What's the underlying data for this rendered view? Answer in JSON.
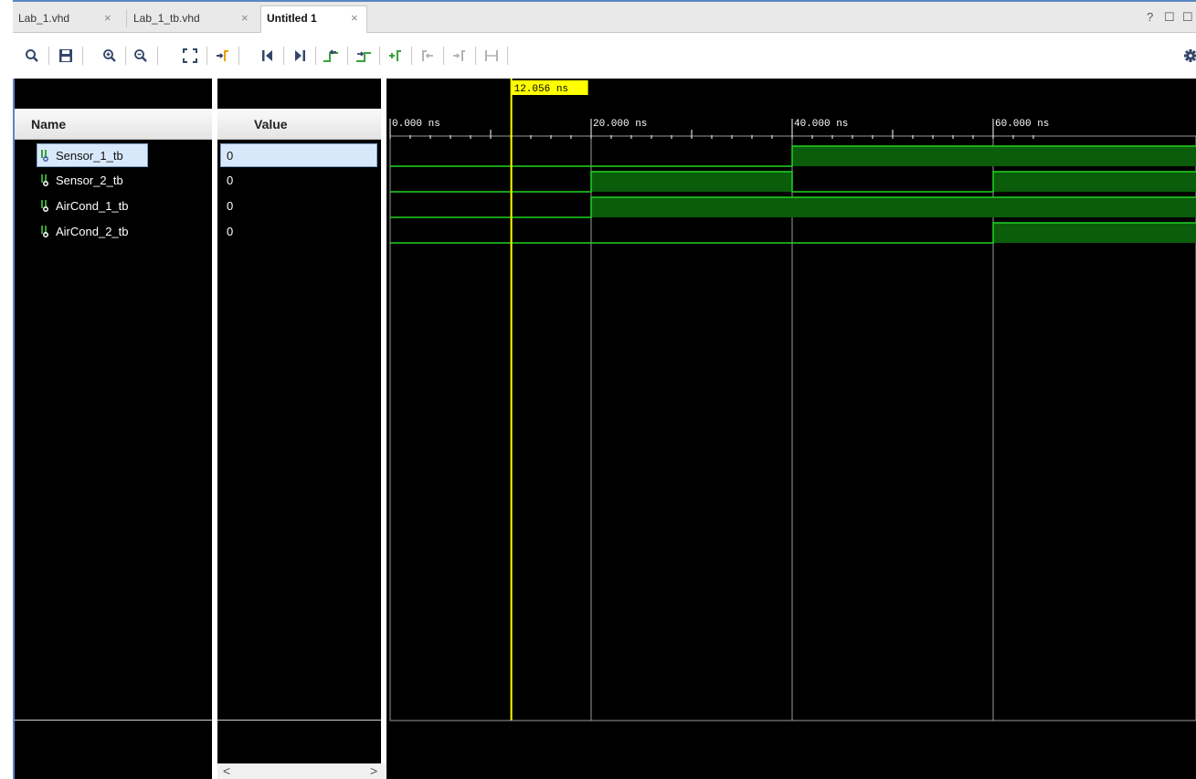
{
  "tabs": [
    {
      "label": "Lab_1.vhd",
      "active": false
    },
    {
      "label": "Lab_1_tb.vhd",
      "active": false
    },
    {
      "label": "Untitled 1",
      "active": true
    }
  ],
  "tab_close_glyph": "×",
  "window_controls": [
    "?",
    "☐",
    "☐"
  ],
  "toolbar": {
    "buttons": [
      {
        "icon": "search-icon",
        "enabled": true
      },
      {
        "icon": "save-icon",
        "enabled": true
      },
      {
        "icon": "zoom-in-icon",
        "enabled": true
      },
      {
        "icon": "zoom-out-icon",
        "enabled": true
      },
      {
        "icon": "zoom-fit-icon",
        "enabled": true
      },
      {
        "icon": "go-to-cursor-icon",
        "enabled": true
      },
      {
        "icon": "go-to-time-zero-icon",
        "enabled": true
      },
      {
        "icon": "go-to-last-time-icon",
        "enabled": true
      },
      {
        "icon": "previous-transition-icon",
        "enabled": true
      },
      {
        "icon": "next-transition-icon",
        "enabled": true
      },
      {
        "icon": "add-marker-icon",
        "enabled": true
      },
      {
        "icon": "previous-marker-icon",
        "enabled": false
      },
      {
        "icon": "next-marker-icon",
        "enabled": false
      },
      {
        "icon": "swap-cursors-icon",
        "enabled": false
      },
      {
        "icon": "settings-gear-icon",
        "enabled": true
      }
    ]
  },
  "columns": {
    "name": "Name",
    "value": "Value"
  },
  "signals": [
    {
      "name": "Sensor_1_tb",
      "value": "0",
      "selected": true
    },
    {
      "name": "Sensor_2_tb",
      "value": "0",
      "selected": false
    },
    {
      "name": "AirCond_1_tb",
      "value": "0",
      "selected": false
    },
    {
      "name": "AirCond_2_tb",
      "value": "0",
      "selected": false
    }
  ],
  "scroll": {
    "left": "<",
    "right": ">"
  },
  "waveform": {
    "cursor_label": "12.056 ns",
    "cursor_time_ns": 12.056,
    "time_window_ns": [
      0,
      64.6
    ],
    "ruler_labels": [
      {
        "time_ns": 0,
        "label": "0.000 ns"
      },
      {
        "time_ns": 20,
        "label": "20.000 ns"
      },
      {
        "time_ns": 40,
        "label": "40.000 ns"
      },
      {
        "time_ns": 60,
        "label": "60.000 ns"
      }
    ],
    "segments": {
      "Sensor_1_tb": [
        {
          "start": 0,
          "value": 0
        },
        {
          "start": 40,
          "value": 1
        }
      ],
      "Sensor_2_tb": [
        {
          "start": 0,
          "value": 0
        },
        {
          "start": 20,
          "value": 1
        },
        {
          "start": 40,
          "value": 0
        },
        {
          "start": 60,
          "value": 1
        }
      ],
      "AirCond_1_tb": [
        {
          "start": 0,
          "value": 0
        },
        {
          "start": 20,
          "value": 1
        }
      ],
      "AirCond_2_tb": [
        {
          "start": 0,
          "value": 0
        },
        {
          "start": 60,
          "value": 1
        }
      ]
    },
    "colors": {
      "wave": "#21d421",
      "fill": "#0b5c0b",
      "cursor": "#ffff00",
      "grid": "#9a9a9a"
    }
  }
}
